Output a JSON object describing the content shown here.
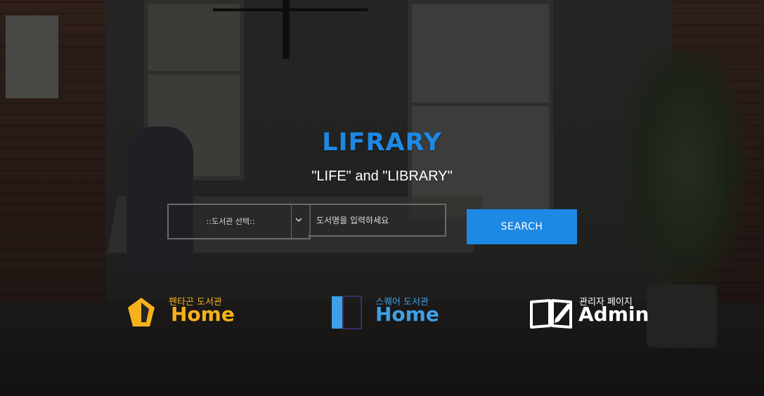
{
  "brand": {
    "title": "LIFRARY",
    "tagline": "\"LIFE\" and \"LIBRARY\"",
    "accent_color": "#1e88e5"
  },
  "search": {
    "library_select": {
      "selected": "::도서관 선택::",
      "icon": "chevron-down-icon"
    },
    "input_placeholder": "도서명을 입력하세요",
    "button_label": "SEARCH"
  },
  "quick_links": [
    {
      "subtitle": "펜타곤 도서관",
      "label": "Home",
      "icon": "pentagon-icon",
      "color": "#f5b21b"
    },
    {
      "subtitle": "스퀘어 도서관",
      "label": "Home",
      "icon": "square-icon",
      "color": "#3ea0e6"
    },
    {
      "subtitle": "관리자 페이지",
      "label": "Admin",
      "icon": "open-book-pen-icon",
      "color": "#ffffff"
    }
  ]
}
